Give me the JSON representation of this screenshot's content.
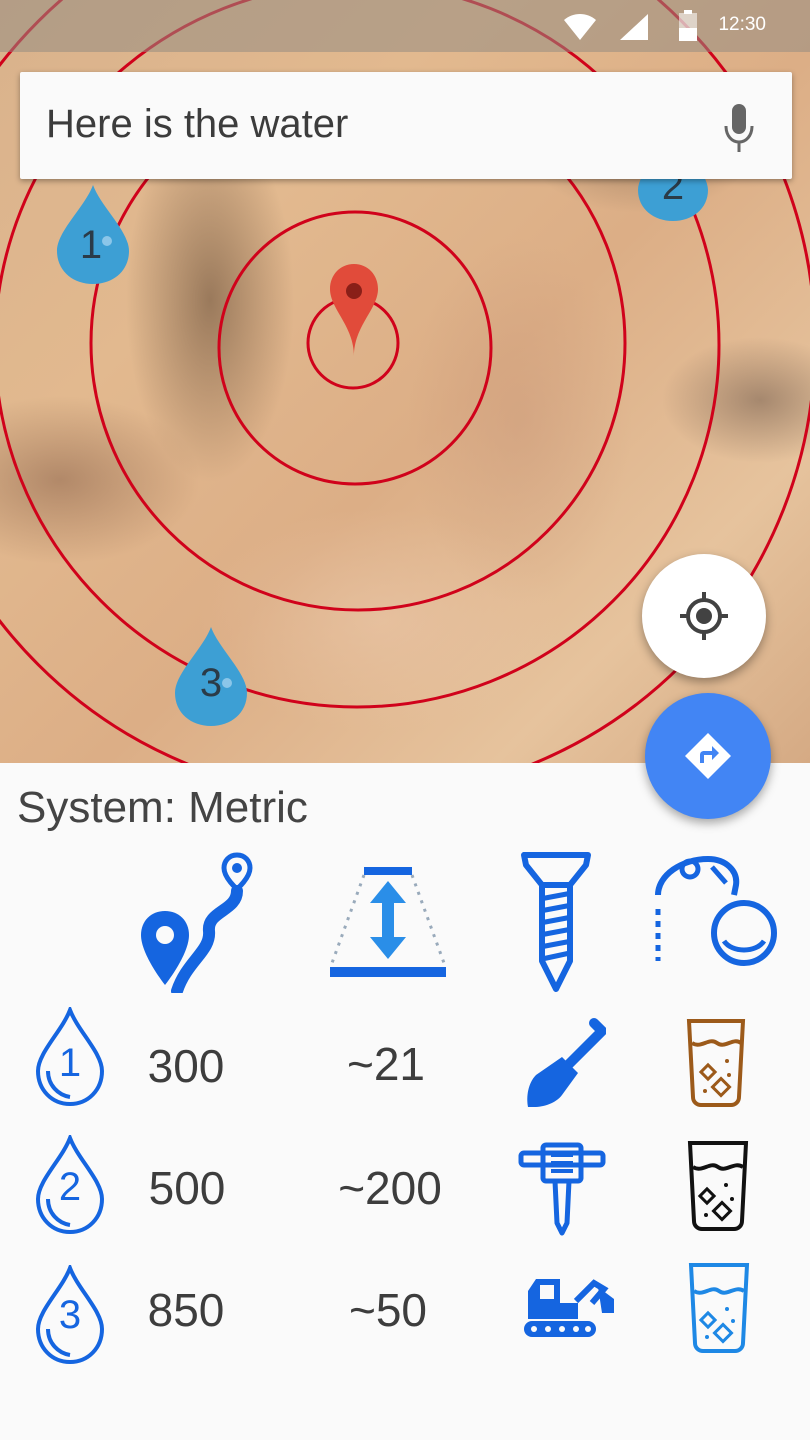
{
  "status_bar": {
    "time": "12:30"
  },
  "search": {
    "query": "Here is the water"
  },
  "map": {
    "markers": [
      {
        "label": "1"
      },
      {
        "label": "2"
      },
      {
        "label": "3"
      }
    ]
  },
  "panel": {
    "system_label": "System: Metric",
    "rows": [
      {
        "index": "1",
        "distance": "300",
        "depth": "~21",
        "tool": "shovel-icon",
        "water": "muddy-water-glass-icon"
      },
      {
        "index": "2",
        "distance": "500",
        "depth": "~200",
        "tool": "jackhammer-icon",
        "water": "water-glass-icon"
      },
      {
        "index": "3",
        "distance": "850",
        "depth": "~50",
        "tool": "excavator-icon",
        "water": "clean-water-glass-icon"
      }
    ]
  },
  "colors": {
    "accent": "#1565e0",
    "ring": "#d0021b",
    "marker": "#3d9fd4",
    "fab": "#4285f4",
    "muddy": "#9c5a1a"
  }
}
